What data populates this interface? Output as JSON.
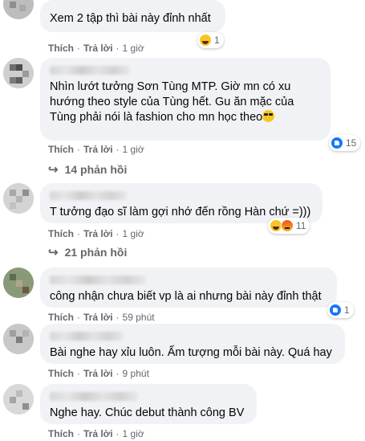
{
  "labels": {
    "like": "Thích",
    "reply": "Trả lời",
    "dot": "·"
  },
  "comments": [
    {
      "text": "Xem 2 tập thì bài này đỉnh nhất",
      "time": "1 giờ",
      "reactions": [
        "haha"
      ],
      "reaction_count": "1"
    },
    {
      "text": "Nhìn lướt tưởng Sơn Tùng MTP. Giờ mn có xu hướng theo style của Tùng hết. Gu ăn mặc của Tùng phải nói là fashion cho mn học theo",
      "time": "1 giờ",
      "reactions": [
        "like"
      ],
      "reaction_count": "15",
      "replies": "14 phản hồi"
    },
    {
      "text": "T tưởng đạo sĩ làm gợi nhớ đến rồng Hàn chứ =)))",
      "time": "1 giờ",
      "reactions": [
        "haha",
        "angry"
      ],
      "reaction_count": "11",
      "replies": "21 phản hồi"
    },
    {
      "text": "công nhận chưa biết vp là ai nhưng bài này đỉnh thật",
      "time": "59 phút",
      "reactions": [
        "like"
      ],
      "reaction_count": "1"
    },
    {
      "text": "Bài nghe hay xỉu luôn. Ấm tượng mỗi bài này. Quá hay",
      "time": "9 phút"
    },
    {
      "text": "Nghe hay. Chúc debut thành công BV",
      "time": "1 giờ"
    }
  ],
  "colors": {
    "bubble": "#f0f2f5",
    "meta": "#65676b",
    "like_blue": "#1877f2"
  }
}
